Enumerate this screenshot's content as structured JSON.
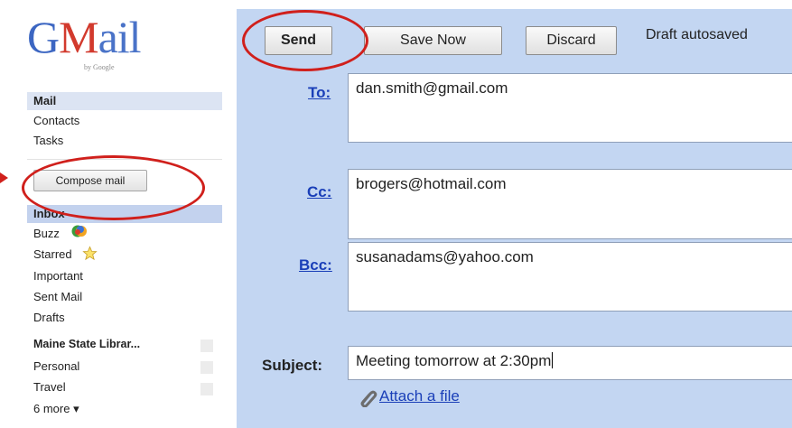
{
  "logo": {
    "sub": "by Google"
  },
  "nav": {
    "mail": "Mail",
    "contacts": "Contacts",
    "tasks": "Tasks",
    "compose": "Compose mail",
    "inbox": "Inbox",
    "buzz": "Buzz",
    "starred": "Starred",
    "important": "Important",
    "sent": "Sent Mail",
    "drafts": "Drafts",
    "labels_header": "Maine State Librar...",
    "personal": "Personal",
    "travel": "Travel",
    "more": "6 more ▾"
  },
  "toolbar": {
    "send": "Send",
    "save": "Save Now",
    "discard": "Discard",
    "status": "Draft autosaved"
  },
  "fields": {
    "to_label": "To:",
    "to_value": "dan.smith@gmail.com",
    "cc_label": "Cc:",
    "cc_value": "brogers@hotmail.com",
    "bcc_label": "Bcc:",
    "bcc_value": "susanadams@yahoo.com",
    "subject_label": "Subject:",
    "subject_value": "Meeting tomorrow at 2:30pm"
  },
  "attach": "Attach a file",
  "colors": {
    "panel": "#c3d6f2",
    "link": "#1a3fb8",
    "annotation_red": "#d0201c",
    "inbox_highlight": "#c3d2ee"
  }
}
